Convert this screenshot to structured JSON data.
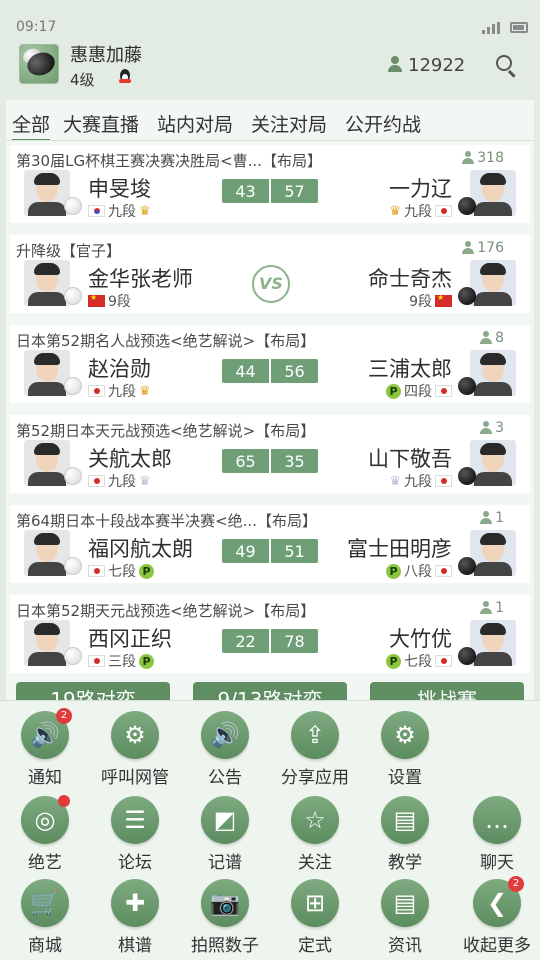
{
  "status_bar": {
    "time": "09:17"
  },
  "header": {
    "username": "惠惠加藤",
    "level": "4级",
    "online_count": "12922"
  },
  "tabs": [
    {
      "label": "全部",
      "active": true
    },
    {
      "label": "大赛直播"
    },
    {
      "label": "站内对局"
    },
    {
      "label": "关注对局"
    },
    {
      "label": "公开约战"
    }
  ],
  "matches": [
    {
      "title": "第30届LG杯棋王赛决赛决胜局<曹...【布局】",
      "viewers": "318",
      "left": {
        "name": "申旻埈",
        "flag": "kr",
        "rank": "九段",
        "crown": true,
        "stone": "white"
      },
      "right": {
        "name": "一力辽",
        "flag": "jp",
        "rank": "九段",
        "crown": true,
        "stone": "black"
      },
      "score": [
        "43",
        "57"
      ]
    },
    {
      "title": "升降级【官子】",
      "viewers": "176",
      "left": {
        "name": "金华张老师",
        "flag": "cn",
        "rank": "9段",
        "stone": "white"
      },
      "right": {
        "name": "命士奇杰",
        "flag": "cn",
        "rank": "9段",
        "stone": "black"
      },
      "vs": "VS"
    },
    {
      "title": "日本第52期名人战预选<绝艺解说>【布局】",
      "viewers": "8",
      "left": {
        "name": "赵治勋",
        "flag": "jp",
        "rank": "九段",
        "crown": true,
        "stone": "white"
      },
      "right": {
        "name": "三浦太郎",
        "flag": "jp",
        "rank": "四段",
        "p": "P",
        "stone": "black"
      },
      "score": [
        "44",
        "56"
      ]
    },
    {
      "title": "第52期日本天元战预选<绝艺解说>【布局】",
      "viewers": "3",
      "left": {
        "name": "关航太郎",
        "flag": "jp",
        "rank": "九段",
        "crown_pale": true,
        "stone": "white"
      },
      "right": {
        "name": "山下敬吾",
        "flag": "jp",
        "rank": "九段",
        "crown_pale": true,
        "stone": "black"
      },
      "score": [
        "65",
        "35"
      ]
    },
    {
      "title": "第64期日本十段战本赛半决赛<绝...【布局】",
      "viewers": "1",
      "left": {
        "name": "福冈航太朗",
        "flag": "jp",
        "rank": "七段",
        "p": "P",
        "stone": "white"
      },
      "right": {
        "name": "富士田明彦",
        "flag": "jp",
        "rank": "八段",
        "p": "P",
        "stone": "black"
      },
      "score": [
        "49",
        "51"
      ]
    },
    {
      "title": "日本第52期天元战预选<绝艺解说>【布局】",
      "viewers": "1",
      "left": {
        "name": "西冈正织",
        "flag": "jp",
        "rank": "三段",
        "p": "P",
        "stone": "white"
      },
      "right": {
        "name": "大竹优",
        "flag": "jp",
        "rank": "七段",
        "p": "P",
        "stone": "black"
      },
      "score": [
        "22",
        "78"
      ]
    }
  ],
  "quick_buttons": [
    "19路对弈",
    "9/13路对弈",
    "挑战赛"
  ],
  "menu": [
    {
      "label": "通知",
      "icon": "speaker-icon",
      "glyph": "🔊",
      "badge": "2"
    },
    {
      "label": "呼叫网管",
      "icon": "support-icon",
      "glyph": "⚙"
    },
    {
      "label": "公告",
      "icon": "speaker-icon",
      "glyph": "🔊"
    },
    {
      "label": "分享应用",
      "icon": "share-icon",
      "glyph": "⇪"
    },
    {
      "label": "设置",
      "icon": "gear-icon",
      "glyph": "⚙"
    },
    {
      "label": "绝艺",
      "icon": "jueyi-icon",
      "glyph": "◎",
      "dot": true
    },
    {
      "label": "论坛",
      "icon": "chat-icon",
      "glyph": "☰"
    },
    {
      "label": "记谱",
      "icon": "record-icon",
      "glyph": "◩"
    },
    {
      "label": "关注",
      "icon": "star-icon",
      "glyph": "☆"
    },
    {
      "label": "教学",
      "icon": "book-icon",
      "glyph": "▤"
    },
    {
      "label": "聊天",
      "icon": "chat-bubble-icon",
      "glyph": "…"
    },
    {
      "label": "商城",
      "icon": "cart-icon",
      "glyph": "🛒"
    },
    {
      "label": "棋谱",
      "icon": "board-icon",
      "glyph": "✚"
    },
    {
      "label": "拍照数子",
      "icon": "camera-icon",
      "glyph": "📷"
    },
    {
      "label": "定式",
      "icon": "grid-icon",
      "glyph": "⊞"
    },
    {
      "label": "资讯",
      "icon": "news-icon",
      "glyph": "▤"
    },
    {
      "label": "收起更多",
      "icon": "collapse-icon",
      "glyph": "❮",
      "badge": "2"
    }
  ]
}
